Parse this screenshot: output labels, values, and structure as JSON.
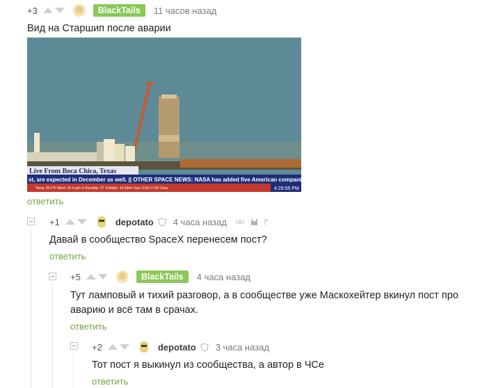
{
  "comments": [
    {
      "score": "+3",
      "author": "BlackTails",
      "author_badge": true,
      "time": "11 часов назад",
      "text": "Вид на Старшип после аварии",
      "reply": "ответить"
    },
    {
      "score": "+1",
      "author": "depotato",
      "author_badge": false,
      "time": "4 часа назад",
      "text": "Давай в сообщество SpaceX перенесем пост?",
      "reply": "ответить"
    },
    {
      "score": "+5",
      "author": "BlackTails",
      "author_badge": true,
      "time": "4 часа назад",
      "text": "Тут ламповый и тихий разговор, а в сообществе уже Маскохейтер вкинул пост про аварию и всё там в срачах.",
      "reply": "ответить"
    },
    {
      "score": "+2",
      "author": "depotato",
      "author_badge": false,
      "time": "3 часа назад",
      "text": "Тот пост я выкинул из сообщества, а автор в ЧСе",
      "reply": "ответить"
    }
  ],
  "photo": {
    "lower_third": "Live From Boca Chica, Texas",
    "ticker": "st, are expected in December as well. || OTHER SPACE NEWS:  NASA has added five American companies to the",
    "weather": "Temp: 80.2°F  Wind: 24.1mph S  Humidity: 57  Visibility: 16.09km  Sun: 6:50-17:36  Clear",
    "clock": "4:29:55 PM"
  },
  "colors": {
    "accent_green": "#75a440",
    "badge_green": "#8ac858",
    "sky": "#5d8a96"
  }
}
